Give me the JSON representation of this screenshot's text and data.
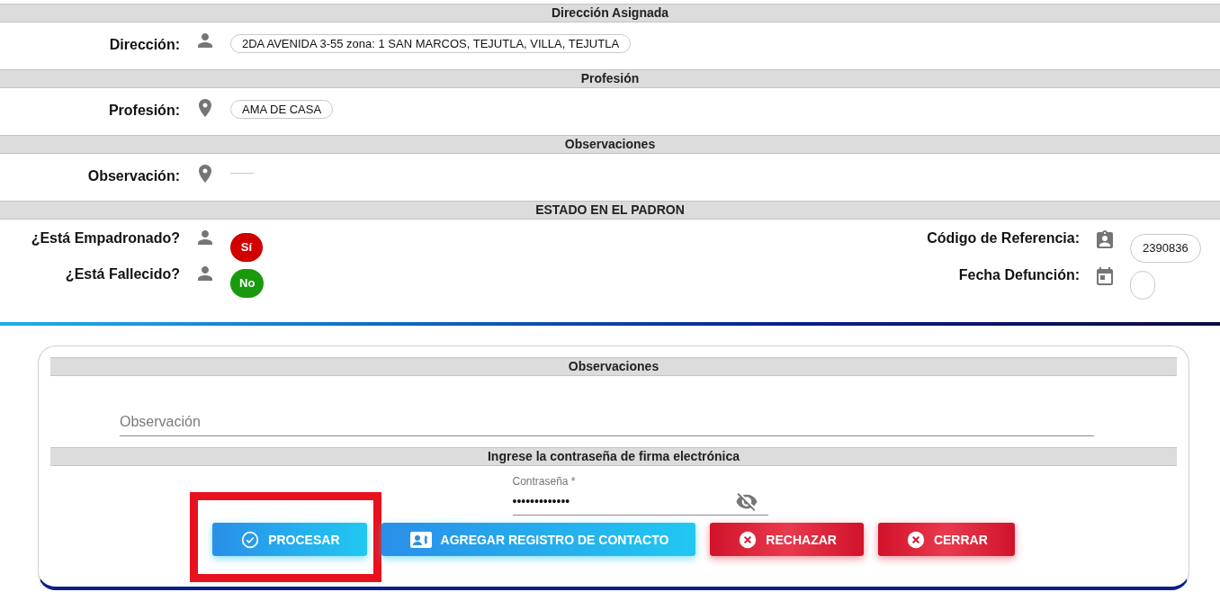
{
  "sections": [
    {
      "title": "Dirección Asignada",
      "rows": [
        {
          "label": "Dirección:",
          "kind": "person",
          "value": "2DA AVENIDA 3-55 zona: 1 SAN MARCOS, TEJUTLA, VILLA, TEJUTLA"
        }
      ]
    },
    {
      "title": "Profesión",
      "rows": [
        {
          "label": "Profesión:",
          "kind": "place",
          "value": "AMA DE CASA"
        }
      ]
    },
    {
      "title": "Observaciones",
      "rows": [
        {
          "label": "Observación:",
          "kind": "place"
        }
      ]
    }
  ],
  "padron": {
    "title": "ESTADO EN EL PADRON",
    "left": [
      {
        "label": "¿Está Empadronado?",
        "kind": "person",
        "badge": "Sí",
        "color": "#d00000"
      },
      {
        "label": "¿Está Fallecido?",
        "kind": "person",
        "badge": "No",
        "color": "#19990c"
      }
    ],
    "right": [
      {
        "label": "Código de Referencia:",
        "kind": "reference",
        "value": "2390836"
      },
      {
        "label": "Fecha Defunción:",
        "kind": "date"
      }
    ]
  },
  "form": {
    "observations_title": "Observaciones",
    "observation": {
      "placeholder": "Observación"
    },
    "signature_title": "Ingrese la contraseña de firma electrónica",
    "password": {
      "label": "Contraseña *",
      "value": "•••••••••••••"
    },
    "buttons": [
      {
        "label": "PROCESAR",
        "kind": "process",
        "highlighted": true
      },
      {
        "label": "AGREGAR REGISTRO DE CONTACTO",
        "kind": "contact",
        "highlighted": false
      },
      {
        "label": "RECHAZAR",
        "kind": "reject",
        "highlighted": false
      },
      {
        "label": "CERRAR",
        "kind": "close",
        "highlighted": false
      }
    ]
  }
}
